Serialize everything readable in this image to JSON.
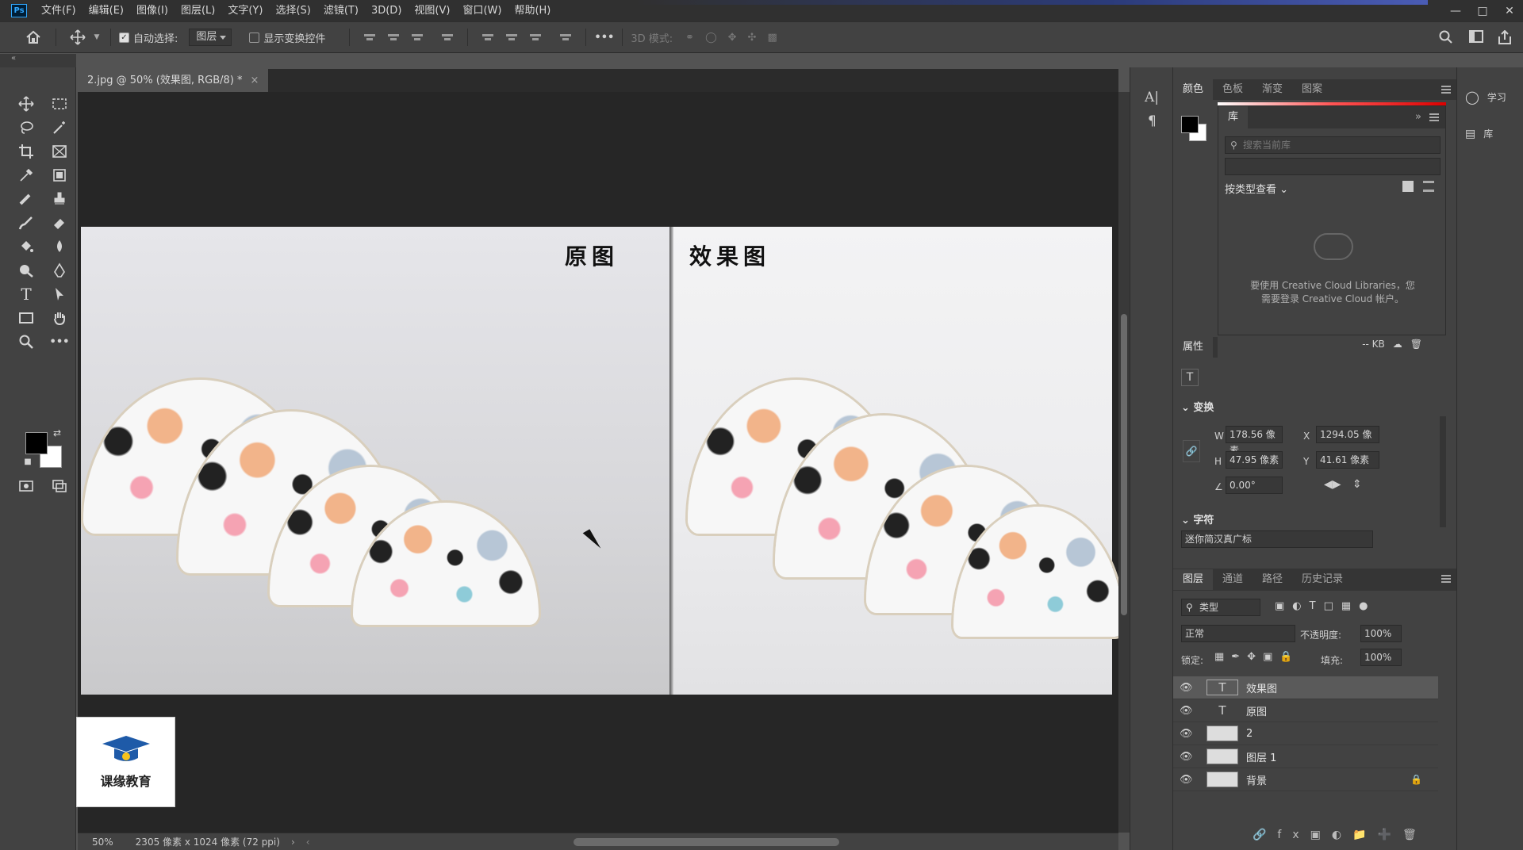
{
  "app": {
    "logo": "Ps"
  },
  "menu": [
    "文件(F)",
    "编辑(E)",
    "图像(I)",
    "图层(L)",
    "文字(Y)",
    "选择(S)",
    "滤镜(T)",
    "3D(D)",
    "视图(V)",
    "窗口(W)",
    "帮助(H)"
  ],
  "options": {
    "auto_select_label": "自动选择:",
    "auto_select_checked": true,
    "auto_select_target": "图层",
    "show_transform_label": "显示变换控件",
    "show_transform_checked": false,
    "more": "•••",
    "mode_3d": "3D 模式:"
  },
  "document": {
    "tab_title": "2.jpg @ 50% (效果图, RGB/8) *",
    "label_original": "原图",
    "label_effect": "效果图",
    "watermark_title": "课缘教育"
  },
  "status": {
    "zoom": "50%",
    "info": "2305 像素 x 1024 像素 (72 ppi)"
  },
  "color_panel": {
    "tabs": [
      "颜色",
      "色板",
      "渐变",
      "图案"
    ],
    "active": 0
  },
  "library": {
    "tab": "库",
    "search_placeholder": "搜索当前库",
    "view_by": "按类型查看",
    "message_line1": "要使用 Creative Cloud Libraries，您",
    "message_line2": "需要登录 Creative Cloud 帐户。",
    "size": "-- KB"
  },
  "properties": {
    "tab": "属性",
    "transform_title": "变换",
    "w_label": "W",
    "w_value": "178.56 像素",
    "x_label": "X",
    "x_value": "1294.05 像",
    "h_label": "H",
    "h_value": "47.95 像素",
    "y_label": "Y",
    "y_value": "41.61 像素",
    "angle": "0.00°",
    "character_title": "字符",
    "font": "迷你简汉真广标"
  },
  "layers_panel": {
    "tabs": [
      "图层",
      "通道",
      "路径",
      "历史记录"
    ],
    "active": 0,
    "filter": "类型",
    "blend_mode": "正常",
    "opacity_label": "不透明度:",
    "opacity": "100%",
    "lock_label": "锁定:",
    "fill_label": "填充:",
    "fill": "100%",
    "layers": [
      {
        "name": "效果图",
        "kind": "text",
        "selected": true
      },
      {
        "name": "原图",
        "kind": "text",
        "selected": false
      },
      {
        "name": "2",
        "kind": "image",
        "selected": false
      },
      {
        "name": "图层 1",
        "kind": "image",
        "selected": false
      },
      {
        "name": "背景",
        "kind": "image",
        "selected": false,
        "locked": true
      }
    ]
  },
  "far_right": {
    "learn": "学习",
    "library": "库"
  }
}
